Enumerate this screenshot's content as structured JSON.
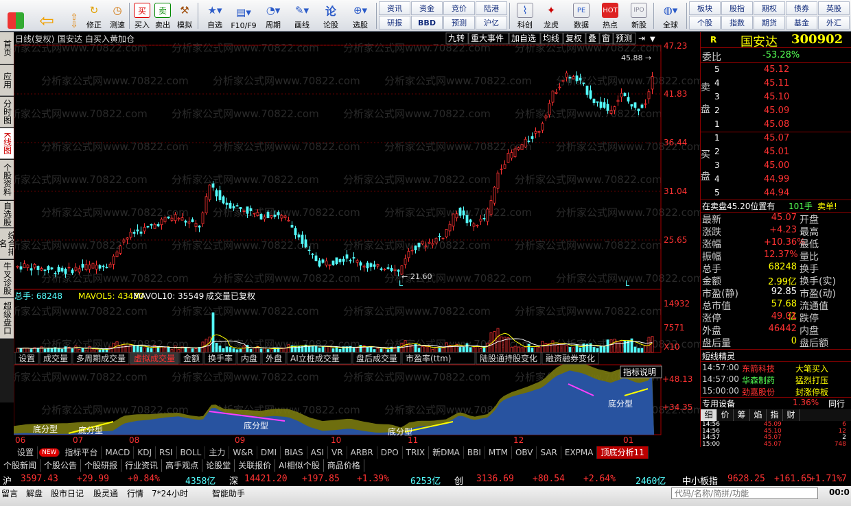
{
  "toolbar": {
    "buttons": [
      "修正",
      "测速",
      "买入",
      "卖出",
      "模拟",
      "自选",
      "F10/F9",
      "周期",
      "画线",
      "论股",
      "选股",
      "科创",
      "龙虎",
      "数据",
      "热点",
      "新股",
      "全球"
    ],
    "grid": [
      [
        "资讯",
        "资金",
        "竞价",
        "陆港"
      ],
      [
        "研报",
        "BBD",
        "预测",
        "沪亿"
      ]
    ],
    "grid2": [
      [
        "板块",
        "股指",
        "期权",
        "债券",
        "英股"
      ],
      [
        "个股",
        "指数",
        "期货",
        "基金",
        "外汇"
      ]
    ],
    "buy_icon": "买",
    "sell_icon": "卖",
    "lun_icon": "论"
  },
  "left_tabs": [
    "首页",
    "应用",
    "分时图",
    "K线图",
    "个股资料",
    "自选股",
    "综合排名",
    "牛叉诊股",
    "超级盘口"
  ],
  "chart": {
    "title": "日线(复权)",
    "stock": "国安达",
    "signal": "白买入黄加仓",
    "top_buttons": [
      "九转",
      "重大事件",
      "加自选",
      "均线",
      "复权",
      "叠",
      "窗",
      "预测"
    ],
    "price_ticks": [
      "47.23",
      "41.83",
      "36.44",
      "31.04",
      "25.65"
    ],
    "high_label": "45.88",
    "low_label": "21.60",
    "l_mark": "L",
    "vol_label": "总手: 68248",
    "ma5_label": "MAVOL5: 43430",
    "ma10_label": "MAVOL10: 35549",
    "vol_note": "成交量已复权",
    "vol_ticks": [
      "14932",
      "7571",
      "X10"
    ],
    "sub_tabs": [
      "设置",
      "成交量",
      "多周期成交量",
      "虚拟成交量",
      "金额",
      "换手率",
      "内盘",
      "外盘",
      "AI立桩成交量",
      "盘后成交量",
      "市盈率(ttm)",
      "陆股通持股变化",
      "融资融券变化"
    ],
    "ind_explain": "指标说明",
    "ind_ticks": [
      "+48.13",
      "+34.35"
    ],
    "pattern": "底分型",
    "x_labels": [
      "06",
      "07",
      "08",
      "09",
      "10",
      "11",
      "12",
      "01"
    ],
    "watermark": "分析家公式网www.70822.com"
  },
  "right": {
    "code_r": "R",
    "name": "国安达",
    "code": "300902",
    "weibi_label": "委比",
    "weibi": "-53.28%",
    "sell": [
      [
        "5",
        "45.12"
      ],
      [
        "4",
        "45.11"
      ],
      [
        "3",
        "45.10"
      ],
      [
        "2",
        "45.09"
      ],
      [
        "1",
        "45.08"
      ]
    ],
    "buy": [
      [
        "1",
        "45.07"
      ],
      [
        "2",
        "45.01"
      ],
      [
        "3",
        "45.00"
      ],
      [
        "4",
        "44.99"
      ],
      [
        "5",
        "44.94"
      ]
    ],
    "sell_label1": "卖",
    "sell_label2": "盘",
    "buy_label1": "买",
    "buy_label2": "盘",
    "note": "在卖盘45.20位置有",
    "note_qty": "101手",
    "note_tag": "卖单!",
    "stats": [
      [
        "最新",
        "45.07",
        "开盘"
      ],
      [
        "涨跌",
        "+4.23",
        "最高"
      ],
      [
        "涨幅",
        "+10.36%",
        "最低"
      ],
      [
        "振幅",
        "12.37%",
        "量比"
      ],
      [
        "总手",
        "68248",
        "换手"
      ],
      [
        "金额",
        "2.99亿",
        "换手(实)"
      ],
      [
        "市盈(静)",
        "92.85",
        "市盈(动)"
      ],
      [
        "总市值",
        "57.68亿",
        "流通值"
      ],
      [
        "涨停",
        "49.01",
        "跌停"
      ],
      [
        "外盘",
        "46442",
        "内盘"
      ],
      [
        "盘后量",
        "0",
        "盘后额"
      ]
    ],
    "short_title": "短线精灵",
    "short": [
      [
        "14:57:00",
        "东箭科技",
        "大笔买入"
      ],
      [
        "14:57:00",
        "华森制药",
        "猛烈打压"
      ],
      [
        "15:00:00",
        "劲嘉股份",
        "封涨停板"
      ]
    ],
    "zy_label": "专用设备",
    "zy_val": "1.36%",
    "zy_tag": "同行",
    "tabs": [
      "细",
      "价",
      "筹",
      "焰",
      "指",
      "财"
    ],
    "ticks": [
      [
        "14:56",
        "45.09",
        "6"
      ],
      [
        "14:56",
        "45.10",
        "12"
      ],
      [
        "14:57",
        "45.07",
        "2"
      ],
      [
        "15:00",
        "45.07",
        "748"
      ]
    ]
  },
  "indicators": [
    "设置",
    "NEW",
    "指标平台",
    "MACD",
    "KDJ",
    "RSI",
    "BOLL",
    "主力",
    "W&R",
    "DMI",
    "BIAS",
    "ASI",
    "VR",
    "ARBR",
    "DPO",
    "TRIX",
    "新DMA",
    "BBI",
    "MTM",
    "OBV",
    "SAR",
    "EXPMA",
    "顶底分析11"
  ],
  "news": [
    "个股新闻",
    "个股公告",
    "个股研报",
    "行业资讯",
    "高手观点",
    "论股堂",
    "关联报价",
    "AI相似个股",
    "商品价格"
  ],
  "index_bar": {
    "sh": "沪",
    "sh_v": "3597.43",
    "sh_c": "+29.99",
    "sh_p": "+0.84%",
    "sh_a": "4358亿",
    "sz": "深",
    "sz_v": "14421.20",
    "sz_c": "+197.85",
    "sz_p": "+1.39%",
    "sz_a": "6253亿",
    "cy": "创",
    "cy_v": "3136.69",
    "cy_c": "+80.54",
    "cy_p": "+2.64%",
    "cy_a": "2460亿",
    "zx": "中小板指",
    "zx_v": "9628.25",
    "zx_c": "+161.65",
    "zx_p": "+1.71%",
    "zx_x": "7"
  },
  "status": [
    "留言",
    "解盘",
    "股市日记",
    "股灵通",
    "行情",
    "7*24小时",
    "智能助手"
  ],
  "search_placeholder": "代码/名称/简拼/功能",
  "clock": "00:0",
  "colors": {
    "up": "#ff3232",
    "down": "#54ffff",
    "yellow": "#ffff00",
    "accent": "#ff3232"
  }
}
